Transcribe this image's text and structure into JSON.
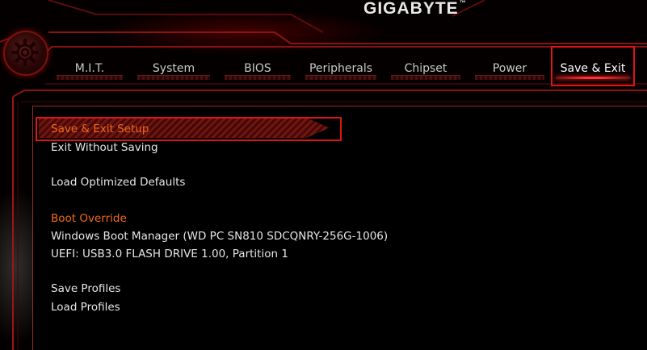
{
  "brand": {
    "name": "GIGABYTE",
    "mark": "™"
  },
  "tabs": [
    {
      "label": "M.I.T.",
      "active": false
    },
    {
      "label": "System",
      "active": false
    },
    {
      "label": "BIOS",
      "active": false
    },
    {
      "label": "Peripherals",
      "active": false
    },
    {
      "label": "Chipset",
      "active": false
    },
    {
      "label": "Power",
      "active": false
    },
    {
      "label": "Save & Exit",
      "active": true
    }
  ],
  "menu": {
    "save_exit_setup": "Save & Exit Setup",
    "exit_without_saving": "Exit Without Saving",
    "load_optimized_defaults": "Load Optimized Defaults",
    "boot_override_heading": "Boot Override",
    "boot_options": [
      "Windows Boot Manager (WD PC SN810 SDCQNRY-256G-1006)",
      "UEFI: USB3.0 FLASH DRIVE 1.00, Partition 1"
    ],
    "save_profiles": "Save Profiles",
    "load_profiles": "Load Profiles"
  },
  "colors": {
    "accent_red": "#e01414",
    "heading_orange": "#f06a1a",
    "text": "#e6e6e6",
    "background": "#000000"
  },
  "icons": {
    "logo": "gear-icon"
  }
}
